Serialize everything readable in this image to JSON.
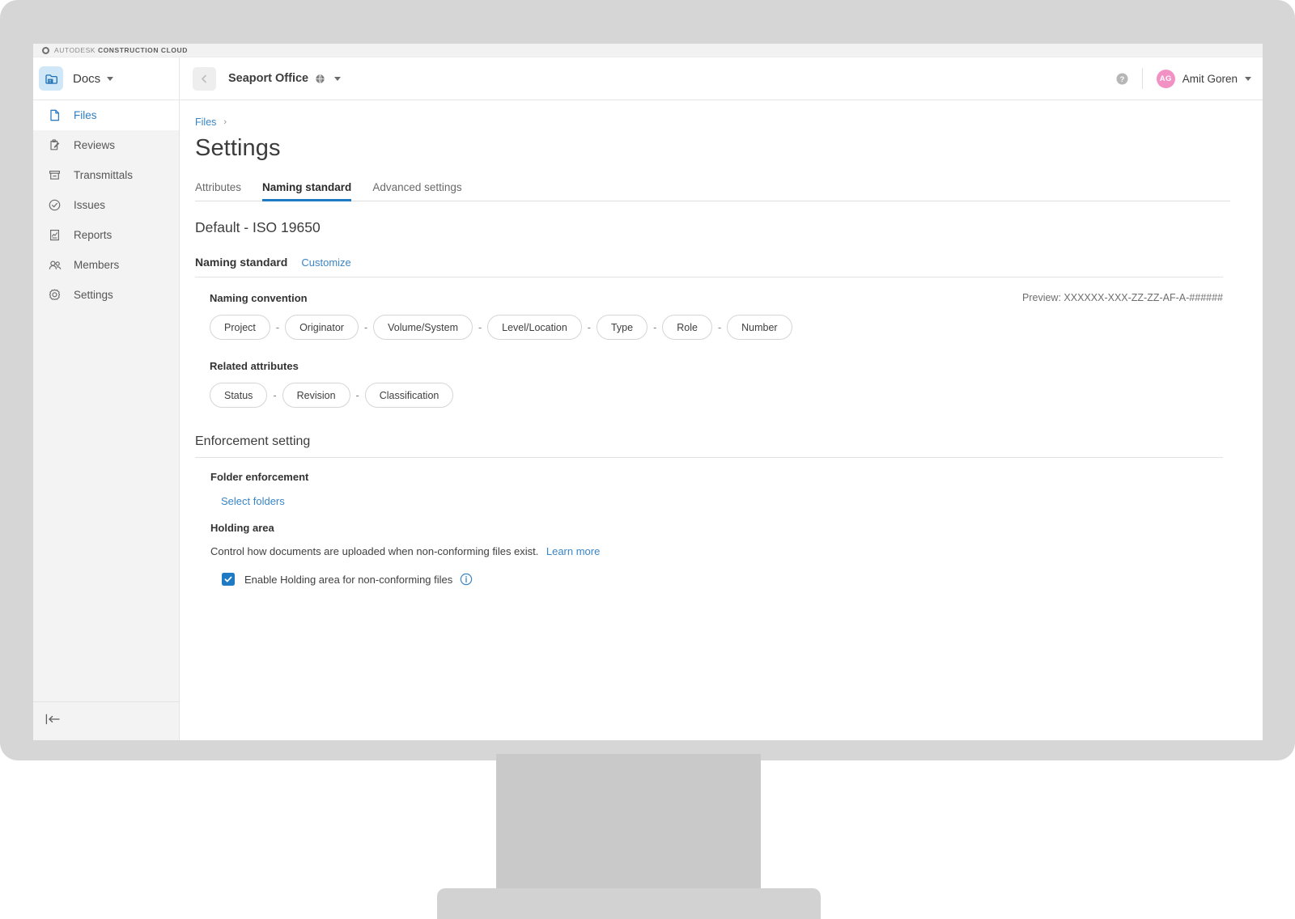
{
  "brand": {
    "prefix": "AUTODESK",
    "suffix": "CONSTRUCTION CLOUD",
    "mark_icon": "autodesk-logo-icon"
  },
  "topbar": {
    "app_name": "Docs",
    "app_icon": "docs-app-icon",
    "app_caret_icon": "chevron-down-icon",
    "back_icon": "back-arrow-icon",
    "project_name": "Seaport Office",
    "project_globe_icon": "globe-icon",
    "project_caret_icon": "chevron-down-icon",
    "help_icon": "help-circle-icon",
    "avatar_initials": "AG",
    "avatar_color": "#f291c4",
    "user_name": "Amit Goren",
    "user_caret_icon": "chevron-down-icon"
  },
  "sidebar": {
    "items": [
      {
        "label": "Files",
        "icon": "file-icon",
        "active": true
      },
      {
        "label": "Reviews",
        "icon": "review-icon",
        "active": false
      },
      {
        "label": "Transmittals",
        "icon": "transmittal-icon",
        "active": false
      },
      {
        "label": "Issues",
        "icon": "check-circle-icon",
        "active": false
      },
      {
        "label": "Reports",
        "icon": "report-icon",
        "active": false
      },
      {
        "label": "Members",
        "icon": "members-icon",
        "active": false
      },
      {
        "label": "Settings",
        "icon": "gear-icon",
        "active": false
      }
    ],
    "collapse_icon": "collapse-sidebar-icon"
  },
  "breadcrumb": {
    "link": "Files",
    "separator": "›"
  },
  "page": {
    "title": "Settings",
    "tabs": [
      {
        "label": "Attributes",
        "active": false
      },
      {
        "label": "Naming standard",
        "active": true
      },
      {
        "label": "Advanced settings",
        "active": false
      }
    ],
    "standard_title": "Default - ISO 19650"
  },
  "naming_standard": {
    "section_label": "Naming standard",
    "customize_label": "Customize",
    "convention_label": "Naming convention",
    "convention_pills": [
      "Project",
      "Originator",
      "Volume/System",
      "Level/Location",
      "Type",
      "Role",
      "Number"
    ],
    "pill_separator": "-",
    "preview_label": "Preview:",
    "preview_value": "XXXXXX-XXX-ZZ-ZZ-AF-A-######",
    "related_label": "Related attributes",
    "related_pills": [
      "Status",
      "Revision",
      "Classification"
    ]
  },
  "enforcement": {
    "section_label": "Enforcement setting",
    "folder_label": "Folder enforcement",
    "select_folders_link": "Select folders",
    "holding_label": "Holding area",
    "holding_description": "Control how documents are uploaded when non-conforming files exist.",
    "learn_more_link": "Learn more",
    "checkbox_label": "Enable Holding area for non-conforming files",
    "checkbox_checked": true,
    "checkbox_color": "#1f7ac4",
    "info_icon": "info-circle-icon"
  },
  "colors": {
    "accent_blue": "#1f7ac4",
    "link_blue": "#3a85c6",
    "sidebar_bg": "#f3f3f3",
    "monitor_bezel": "#d6d6d6"
  }
}
